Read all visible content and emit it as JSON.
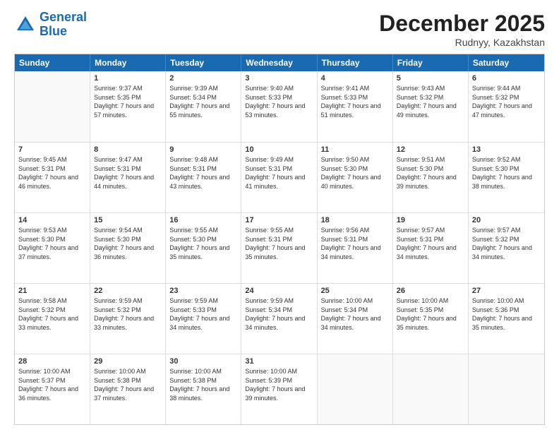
{
  "header": {
    "logo_general": "General",
    "logo_blue": "Blue",
    "month_year": "December 2025",
    "location": "Rudnyy, Kazakhstan"
  },
  "weekdays": [
    "Sunday",
    "Monday",
    "Tuesday",
    "Wednesday",
    "Thursday",
    "Friday",
    "Saturday"
  ],
  "weeks": [
    [
      {
        "day": "",
        "sunrise": "",
        "sunset": "",
        "daylight": ""
      },
      {
        "day": "1",
        "sunrise": "Sunrise: 9:37 AM",
        "sunset": "Sunset: 5:35 PM",
        "daylight": "Daylight: 7 hours and 57 minutes."
      },
      {
        "day": "2",
        "sunrise": "Sunrise: 9:39 AM",
        "sunset": "Sunset: 5:34 PM",
        "daylight": "Daylight: 7 hours and 55 minutes."
      },
      {
        "day": "3",
        "sunrise": "Sunrise: 9:40 AM",
        "sunset": "Sunset: 5:33 PM",
        "daylight": "Daylight: 7 hours and 53 minutes."
      },
      {
        "day": "4",
        "sunrise": "Sunrise: 9:41 AM",
        "sunset": "Sunset: 5:33 PM",
        "daylight": "Daylight: 7 hours and 51 minutes."
      },
      {
        "day": "5",
        "sunrise": "Sunrise: 9:43 AM",
        "sunset": "Sunset: 5:32 PM",
        "daylight": "Daylight: 7 hours and 49 minutes."
      },
      {
        "day": "6",
        "sunrise": "Sunrise: 9:44 AM",
        "sunset": "Sunset: 5:32 PM",
        "daylight": "Daylight: 7 hours and 47 minutes."
      }
    ],
    [
      {
        "day": "7",
        "sunrise": "Sunrise: 9:45 AM",
        "sunset": "Sunset: 5:31 PM",
        "daylight": "Daylight: 7 hours and 46 minutes."
      },
      {
        "day": "8",
        "sunrise": "Sunrise: 9:47 AM",
        "sunset": "Sunset: 5:31 PM",
        "daylight": "Daylight: 7 hours and 44 minutes."
      },
      {
        "day": "9",
        "sunrise": "Sunrise: 9:48 AM",
        "sunset": "Sunset: 5:31 PM",
        "daylight": "Daylight: 7 hours and 43 minutes."
      },
      {
        "day": "10",
        "sunrise": "Sunrise: 9:49 AM",
        "sunset": "Sunset: 5:31 PM",
        "daylight": "Daylight: 7 hours and 41 minutes."
      },
      {
        "day": "11",
        "sunrise": "Sunrise: 9:50 AM",
        "sunset": "Sunset: 5:30 PM",
        "daylight": "Daylight: 7 hours and 40 minutes."
      },
      {
        "day": "12",
        "sunrise": "Sunrise: 9:51 AM",
        "sunset": "Sunset: 5:30 PM",
        "daylight": "Daylight: 7 hours and 39 minutes."
      },
      {
        "day": "13",
        "sunrise": "Sunrise: 9:52 AM",
        "sunset": "Sunset: 5:30 PM",
        "daylight": "Daylight: 7 hours and 38 minutes."
      }
    ],
    [
      {
        "day": "14",
        "sunrise": "Sunrise: 9:53 AM",
        "sunset": "Sunset: 5:30 PM",
        "daylight": "Daylight: 7 hours and 37 minutes."
      },
      {
        "day": "15",
        "sunrise": "Sunrise: 9:54 AM",
        "sunset": "Sunset: 5:30 PM",
        "daylight": "Daylight: 7 hours and 36 minutes."
      },
      {
        "day": "16",
        "sunrise": "Sunrise: 9:55 AM",
        "sunset": "Sunset: 5:30 PM",
        "daylight": "Daylight: 7 hours and 35 minutes."
      },
      {
        "day": "17",
        "sunrise": "Sunrise: 9:55 AM",
        "sunset": "Sunset: 5:31 PM",
        "daylight": "Daylight: 7 hours and 35 minutes."
      },
      {
        "day": "18",
        "sunrise": "Sunrise: 9:56 AM",
        "sunset": "Sunset: 5:31 PM",
        "daylight": "Daylight: 7 hours and 34 minutes."
      },
      {
        "day": "19",
        "sunrise": "Sunrise: 9:57 AM",
        "sunset": "Sunset: 5:31 PM",
        "daylight": "Daylight: 7 hours and 34 minutes."
      },
      {
        "day": "20",
        "sunrise": "Sunrise: 9:57 AM",
        "sunset": "Sunset: 5:32 PM",
        "daylight": "Daylight: 7 hours and 34 minutes."
      }
    ],
    [
      {
        "day": "21",
        "sunrise": "Sunrise: 9:58 AM",
        "sunset": "Sunset: 5:32 PM",
        "daylight": "Daylight: 7 hours and 33 minutes."
      },
      {
        "day": "22",
        "sunrise": "Sunrise: 9:59 AM",
        "sunset": "Sunset: 5:32 PM",
        "daylight": "Daylight: 7 hours and 33 minutes."
      },
      {
        "day": "23",
        "sunrise": "Sunrise: 9:59 AM",
        "sunset": "Sunset: 5:33 PM",
        "daylight": "Daylight: 7 hours and 34 minutes."
      },
      {
        "day": "24",
        "sunrise": "Sunrise: 9:59 AM",
        "sunset": "Sunset: 5:34 PM",
        "daylight": "Daylight: 7 hours and 34 minutes."
      },
      {
        "day": "25",
        "sunrise": "Sunrise: 10:00 AM",
        "sunset": "Sunset: 5:34 PM",
        "daylight": "Daylight: 7 hours and 34 minutes."
      },
      {
        "day": "26",
        "sunrise": "Sunrise: 10:00 AM",
        "sunset": "Sunset: 5:35 PM",
        "daylight": "Daylight: 7 hours and 35 minutes."
      },
      {
        "day": "27",
        "sunrise": "Sunrise: 10:00 AM",
        "sunset": "Sunset: 5:36 PM",
        "daylight": "Daylight: 7 hours and 35 minutes."
      }
    ],
    [
      {
        "day": "28",
        "sunrise": "Sunrise: 10:00 AM",
        "sunset": "Sunset: 5:37 PM",
        "daylight": "Daylight: 7 hours and 36 minutes."
      },
      {
        "day": "29",
        "sunrise": "Sunrise: 10:00 AM",
        "sunset": "Sunset: 5:38 PM",
        "daylight": "Daylight: 7 hours and 37 minutes."
      },
      {
        "day": "30",
        "sunrise": "Sunrise: 10:00 AM",
        "sunset": "Sunset: 5:38 PM",
        "daylight": "Daylight: 7 hours and 38 minutes."
      },
      {
        "day": "31",
        "sunrise": "Sunrise: 10:00 AM",
        "sunset": "Sunset: 5:39 PM",
        "daylight": "Daylight: 7 hours and 39 minutes."
      },
      {
        "day": "",
        "sunrise": "",
        "sunset": "",
        "daylight": ""
      },
      {
        "day": "",
        "sunrise": "",
        "sunset": "",
        "daylight": ""
      },
      {
        "day": "",
        "sunrise": "",
        "sunset": "",
        "daylight": ""
      }
    ]
  ]
}
